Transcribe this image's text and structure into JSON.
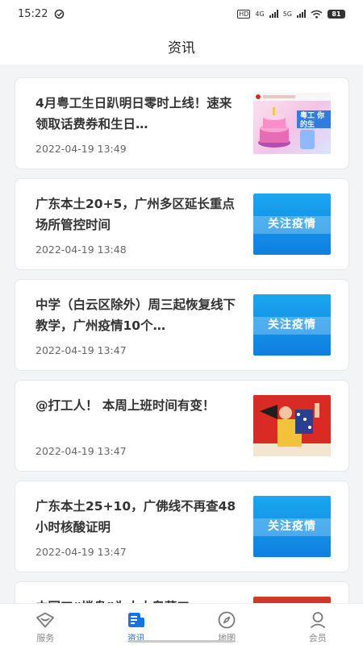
{
  "status_bar": {
    "time": "15:22",
    "network_left": "HD",
    "network_4g": "4G",
    "network_5g": "5G",
    "battery": "81"
  },
  "header": {
    "title": "资讯"
  },
  "articles": [
    {
      "title": "4月粤工生日趴明日零时上线！速来领取话费券和生日…",
      "time": "2022-04-19 13:49",
      "thumb_text": "粤工 你的生"
    },
    {
      "title": "广东本土20+5，广州多区延长重点场所管控时间",
      "time": "2022-04-19 13:48",
      "thumb_text": "关注疫情"
    },
    {
      "title": "中学（白云区除外）周三起恢复线下教学，广州疫情10个…",
      "time": "2022-04-19 13:47",
      "thumb_text": "关注疫情"
    },
    {
      "title": "@打工人！ 本周上班时间有变！",
      "time": "2022-04-19 13:47",
      "thumb_text": ""
    },
    {
      "title": "广东本土25+10，广佛线不再查48小时核酸证明",
      "time": "2022-04-19 13:47",
      "thumb_text": "关注疫情"
    },
    {
      "title": "中国工“楼盘”为十大粤菜工",
      "time": "",
      "thumb_text": ""
    }
  ],
  "tabs": [
    {
      "label": "服务",
      "icon": "service-icon"
    },
    {
      "label": "资讯",
      "icon": "news-icon"
    },
    {
      "label": "地图",
      "icon": "compass-icon"
    },
    {
      "label": "会员",
      "icon": "member-icon"
    }
  ],
  "colors": {
    "accent": "#1473e6",
    "card_bg": "#ffffff",
    "page_bg": "#f3f4f6"
  }
}
